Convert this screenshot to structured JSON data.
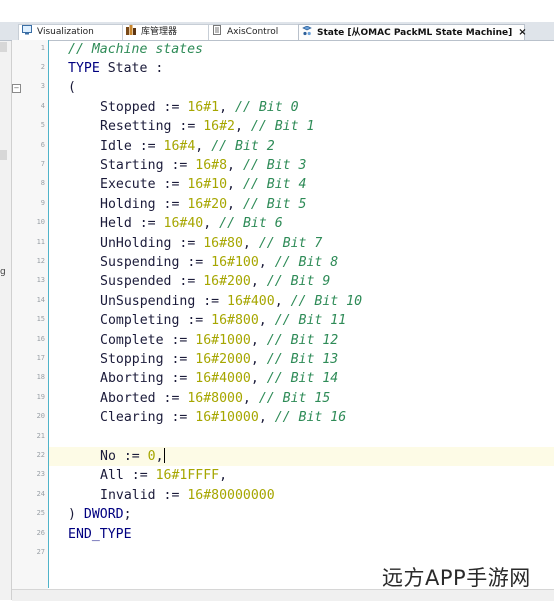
{
  "tabs": [
    {
      "label": "Visualization",
      "active": false
    },
    {
      "label": "库管理器",
      "active": false
    },
    {
      "label": "AxisControl",
      "active": false
    },
    {
      "label": "State [从OMAC PackML State Machine]",
      "active": true
    }
  ],
  "close_glyph": "×",
  "side_letter": "g",
  "fold_glyph": "−",
  "lines": [
    {
      "n": "1",
      "indent": 0,
      "tokens": [
        {
          "t": "// Machine states",
          "c": "cm"
        }
      ]
    },
    {
      "n": "2",
      "indent": 0,
      "tokens": [
        {
          "t": "TYPE",
          "c": "kw"
        },
        {
          "t": " State :",
          "c": ""
        }
      ]
    },
    {
      "n": "3",
      "indent": 0,
      "tokens": [
        {
          "t": "(",
          "c": ""
        }
      ]
    },
    {
      "n": "4",
      "indent": 1,
      "tokens": [
        {
          "t": "Stopped := ",
          "c": ""
        },
        {
          "t": "16#1",
          "c": "num"
        },
        {
          "t": ", ",
          "c": ""
        },
        {
          "t": "// Bit 0",
          "c": "cm"
        }
      ]
    },
    {
      "n": "5",
      "indent": 1,
      "tokens": [
        {
          "t": "Resetting := ",
          "c": ""
        },
        {
          "t": "16#2",
          "c": "num"
        },
        {
          "t": ", ",
          "c": ""
        },
        {
          "t": "// Bit 1",
          "c": "cm"
        }
      ]
    },
    {
      "n": "6",
      "indent": 1,
      "tokens": [
        {
          "t": "Idle := ",
          "c": ""
        },
        {
          "t": "16#4",
          "c": "num"
        },
        {
          "t": ", ",
          "c": ""
        },
        {
          "t": "// Bit 2",
          "c": "cm"
        }
      ]
    },
    {
      "n": "7",
      "indent": 1,
      "tokens": [
        {
          "t": "Starting := ",
          "c": ""
        },
        {
          "t": "16#8",
          "c": "num"
        },
        {
          "t": ", ",
          "c": ""
        },
        {
          "t": "// Bit 3",
          "c": "cm"
        }
      ]
    },
    {
      "n": "8",
      "indent": 1,
      "tokens": [
        {
          "t": "Execute := ",
          "c": ""
        },
        {
          "t": "16#10",
          "c": "num"
        },
        {
          "t": ", ",
          "c": ""
        },
        {
          "t": "// Bit 4",
          "c": "cm"
        }
      ]
    },
    {
      "n": "9",
      "indent": 1,
      "tokens": [
        {
          "t": "Holding := ",
          "c": ""
        },
        {
          "t": "16#20",
          "c": "num"
        },
        {
          "t": ", ",
          "c": ""
        },
        {
          "t": "// Bit 5",
          "c": "cm"
        }
      ]
    },
    {
      "n": "10",
      "indent": 1,
      "tokens": [
        {
          "t": "Held := ",
          "c": ""
        },
        {
          "t": "16#40",
          "c": "num"
        },
        {
          "t": ", ",
          "c": ""
        },
        {
          "t": "// Bit 6",
          "c": "cm"
        }
      ]
    },
    {
      "n": "11",
      "indent": 1,
      "tokens": [
        {
          "t": "UnHolding := ",
          "c": ""
        },
        {
          "t": "16#80",
          "c": "num"
        },
        {
          "t": ", ",
          "c": ""
        },
        {
          "t": "// Bit 7",
          "c": "cm"
        }
      ]
    },
    {
      "n": "12",
      "indent": 1,
      "tokens": [
        {
          "t": "Suspending := ",
          "c": ""
        },
        {
          "t": "16#100",
          "c": "num"
        },
        {
          "t": ", ",
          "c": ""
        },
        {
          "t": "// Bit 8",
          "c": "cm"
        }
      ]
    },
    {
      "n": "13",
      "indent": 1,
      "tokens": [
        {
          "t": "Suspended := ",
          "c": ""
        },
        {
          "t": "16#200",
          "c": "num"
        },
        {
          "t": ", ",
          "c": ""
        },
        {
          "t": "// Bit 9",
          "c": "cm"
        }
      ]
    },
    {
      "n": "14",
      "indent": 1,
      "tokens": [
        {
          "t": "UnSuspending := ",
          "c": ""
        },
        {
          "t": "16#400",
          "c": "num"
        },
        {
          "t": ", ",
          "c": ""
        },
        {
          "t": "// Bit 10",
          "c": "cm"
        }
      ]
    },
    {
      "n": "15",
      "indent": 1,
      "tokens": [
        {
          "t": "Completing := ",
          "c": ""
        },
        {
          "t": "16#800",
          "c": "num"
        },
        {
          "t": ", ",
          "c": ""
        },
        {
          "t": "// Bit 11",
          "c": "cm"
        }
      ]
    },
    {
      "n": "16",
      "indent": 1,
      "tokens": [
        {
          "t": "Complete := ",
          "c": ""
        },
        {
          "t": "16#1000",
          "c": "num"
        },
        {
          "t": ", ",
          "c": ""
        },
        {
          "t": "// Bit 12",
          "c": "cm"
        }
      ]
    },
    {
      "n": "17",
      "indent": 1,
      "tokens": [
        {
          "t": "Stopping := ",
          "c": ""
        },
        {
          "t": "16#2000",
          "c": "num"
        },
        {
          "t": ", ",
          "c": ""
        },
        {
          "t": "// Bit 13",
          "c": "cm"
        }
      ]
    },
    {
      "n": "18",
      "indent": 1,
      "tokens": [
        {
          "t": "Aborting := ",
          "c": ""
        },
        {
          "t": "16#4000",
          "c": "num"
        },
        {
          "t": ", ",
          "c": ""
        },
        {
          "t": "// Bit 14",
          "c": "cm"
        }
      ]
    },
    {
      "n": "19",
      "indent": 1,
      "tokens": [
        {
          "t": "Aborted := ",
          "c": ""
        },
        {
          "t": "16#8000",
          "c": "num"
        },
        {
          "t": ", ",
          "c": ""
        },
        {
          "t": "// Bit 15",
          "c": "cm"
        }
      ]
    },
    {
      "n": "20",
      "indent": 1,
      "tokens": [
        {
          "t": "Clearing := ",
          "c": ""
        },
        {
          "t": "16#10000",
          "c": "num"
        },
        {
          "t": ", ",
          "c": ""
        },
        {
          "t": "// Bit 16",
          "c": "cm"
        }
      ]
    },
    {
      "n": "21",
      "indent": 0,
      "tokens": []
    },
    {
      "n": "22",
      "indent": 1,
      "current": true,
      "tokens": [
        {
          "t": "No := ",
          "c": ""
        },
        {
          "t": "0",
          "c": "num"
        },
        {
          "t": ",",
          "c": ""
        }
      ]
    },
    {
      "n": "23",
      "indent": 1,
      "tokens": [
        {
          "t": "All := ",
          "c": ""
        },
        {
          "t": "16#1FFFF",
          "c": "num"
        },
        {
          "t": ",",
          "c": ""
        }
      ]
    },
    {
      "n": "24",
      "indent": 1,
      "tokens": [
        {
          "t": "Invalid := ",
          "c": ""
        },
        {
          "t": "16#80000000",
          "c": "num"
        }
      ]
    },
    {
      "n": "25",
      "indent": 0,
      "tokens": [
        {
          "t": ") ",
          "c": ""
        },
        {
          "t": "DWORD",
          "c": "kw"
        },
        {
          "t": ";",
          "c": ""
        }
      ]
    },
    {
      "n": "26",
      "indent": 0,
      "tokens": [
        {
          "t": "END_TYPE",
          "c": "kw"
        }
      ]
    },
    {
      "n": "27",
      "indent": 0,
      "tokens": []
    }
  ],
  "watermark": "远方APP手游网"
}
